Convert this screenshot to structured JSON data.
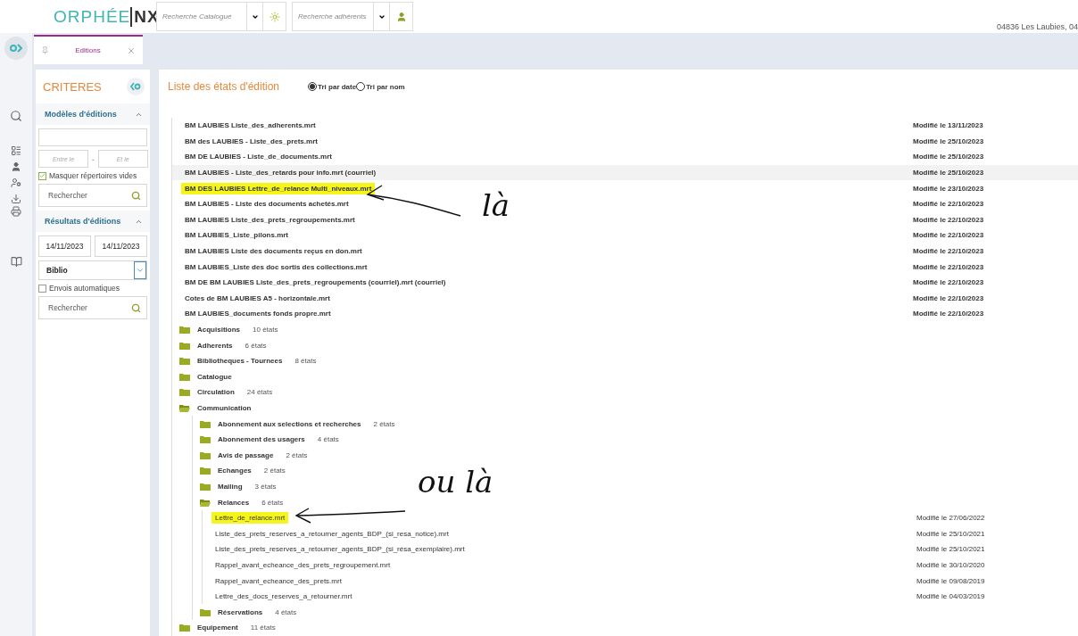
{
  "header": {
    "logo": {
      "part_1": "ORPHÉE",
      "part_2": "NX"
    },
    "catalog_search": {
      "placeholder": "Recherche Catalogue"
    },
    "member_search": {
      "placeholder": "Recherche adhérents"
    },
    "location": "04836 Les Laubies, 04"
  },
  "tabs": [
    {
      "label": "Editions",
      "selected": true
    }
  ],
  "criteria": {
    "title": "CRITERES",
    "models": {
      "title": "Modèles d'éditions",
      "expanded": true,
      "from": {
        "placeholder": "Entre le"
      },
      "separator": "-",
      "to": {
        "placeholder": "Et le"
      },
      "hide_empty": {
        "label": "Masquer répertoires vides",
        "checked": true
      },
      "search": {
        "placeholder": "Rechercher"
      }
    },
    "results": {
      "title": "Résultats d'éditions",
      "expanded": true,
      "from": "14/11/2023",
      "to": "14/11/2023",
      "library": "Biblio",
      "auto_send": {
        "label": "Envois automatiques",
        "checked": false
      },
      "search": {
        "placeholder": "Rechercher"
      }
    }
  },
  "list": {
    "title": "Liste des états d'édition",
    "sort": [
      {
        "label": "Tri par date",
        "selected": true
      },
      {
        "label": "Tri par nom",
        "selected": false
      }
    ],
    "items": [
      {
        "kind": "file",
        "name": "BM LAUBIES Liste_des_adherents.mrt",
        "date": "Modifié le 13/11/2023",
        "highlighted": false,
        "selected": false
      },
      {
        "kind": "file",
        "name": "BM des LAUBIES - Liste_des_prets.mrt",
        "date": "Modifié le 25/10/2023",
        "highlighted": false,
        "selected": false
      },
      {
        "kind": "file",
        "name": "BM DE LAUBIES - Liste_de_documents.mrt",
        "date": "Modifié le 25/10/2023",
        "highlighted": false,
        "selected": false
      },
      {
        "kind": "file",
        "name": "BM LAUBIES - Liste_des_retards pour info.mrt (courriel)",
        "date": "Modifié le 25/10/2023",
        "highlighted": false,
        "selected": true
      },
      {
        "kind": "file",
        "name": "BM DES LAUBIES Lettre_de_relance Multi_niveaux.mrt",
        "date": "Modifié le 23/10/2023",
        "highlighted": true,
        "selected": false
      },
      {
        "kind": "file",
        "name": "BM LAUBIES - Liste des documents achetés.mrt",
        "date": "Modifié le 22/10/2023",
        "highlighted": false,
        "selected": false
      },
      {
        "kind": "file",
        "name": "BM LAUBIES Liste_des_prets_regroupements.mrt",
        "date": "Modifié le 22/10/2023",
        "highlighted": false,
        "selected": false
      },
      {
        "kind": "file",
        "name": "BM LAUBIES_Liste_pilons.mrt",
        "date": "Modifié le 22/10/2023",
        "highlighted": false,
        "selected": false
      },
      {
        "kind": "file",
        "name": "BM LAUBIES Liste des documents reçus en don.mrt",
        "date": "Modifié le 22/10/2023",
        "highlighted": false,
        "selected": false
      },
      {
        "kind": "file",
        "name": "BM LAUBIES_Liste des doc sortis des collections.mrt",
        "date": "Modifié le 22/10/2023",
        "highlighted": false,
        "selected": false
      },
      {
        "kind": "file",
        "name": "BM DE BM LAUBIES Liste_des_prets_regroupements (courriel).mrt (courriel)",
        "date": "Modifié le 22/10/2023",
        "highlighted": false,
        "selected": false
      },
      {
        "kind": "file",
        "name": "Cotes de BM LAUBIES A5 - horizontale.mrt",
        "date": "Modifié le 22/10/2023",
        "highlighted": false,
        "selected": false
      },
      {
        "kind": "file",
        "name": "BM LAUBIES_documents fonds propre.mrt",
        "date": "Modifié le 22/10/2023",
        "highlighted": false,
        "selected": false
      },
      {
        "kind": "folder",
        "name": "Acquisitions",
        "count": "10 états",
        "expanded": false
      },
      {
        "kind": "folder",
        "name": "Adherents",
        "count": "6 états",
        "expanded": false
      },
      {
        "kind": "folder",
        "name": "Bibliotheques - Tournees",
        "count": "8 états",
        "expanded": false
      },
      {
        "kind": "folder",
        "name": "Catalogue",
        "expanded": false
      },
      {
        "kind": "folder",
        "name": "Circulation",
        "count": "24 états",
        "expanded": false
      },
      {
        "kind": "folder",
        "name": "Communication",
        "expanded": true,
        "children": [
          {
            "kind": "folder",
            "name": "Abonnement aux selections et recherches",
            "count": "2 états",
            "expanded": false
          },
          {
            "kind": "folder",
            "name": "Abonnement des usagers",
            "count": "4 états",
            "expanded": false
          },
          {
            "kind": "folder",
            "name": "Avis de passage",
            "count": "2 états",
            "expanded": false
          },
          {
            "kind": "folder",
            "name": "Echanges",
            "count": "2 états",
            "expanded": false
          },
          {
            "kind": "folder",
            "name": "Mailing",
            "count": "3 états",
            "expanded": false
          },
          {
            "kind": "folder",
            "name": "Relances",
            "count": "6 états",
            "expanded": true,
            "children": [
              {
                "kind": "file",
                "name": "Lettre_de_relance.mrt",
                "date": "Modifié le 27/06/2022",
                "highlighted": true,
                "selected": false
              },
              {
                "kind": "file",
                "name": "Liste_des_prets_reserves_a_retourner_agents_BDP_(si_resa_notice).mrt",
                "date": "Modifié le 25/10/2021",
                "highlighted": false,
                "selected": false
              },
              {
                "kind": "file",
                "name": "Liste_des_prets_reserves_a_retourner_agents_BDP_(si_résa_exemplaire).mrt",
                "date": "Modifié le 25/10/2021",
                "highlighted": false,
                "selected": false
              },
              {
                "kind": "file",
                "name": "Rappel_avant_echeance_des_prets_regroupement.mrt",
                "date": "Modifié le 30/10/2020",
                "highlighted": false,
                "selected": false
              },
              {
                "kind": "file",
                "name": "Rappel_avant_echeance_des_prets.mrt",
                "date": "Modifié le 09/08/2019",
                "highlighted": false,
                "selected": false
              },
              {
                "kind": "file",
                "name": "Lettre_des_docs_reserves_a_retourner.mrt",
                "date": "Modifié le 04/03/2019",
                "highlighted": false,
                "selected": false
              }
            ]
          },
          {
            "kind": "folder",
            "name": "Réservations",
            "count": "4 états",
            "expanded": false
          }
        ]
      },
      {
        "kind": "folder",
        "name": "Equipement",
        "count": "11 états",
        "expanded": false
      }
    ]
  },
  "annotations": [
    {
      "text": "là"
    },
    {
      "text": "ou là"
    }
  ]
}
